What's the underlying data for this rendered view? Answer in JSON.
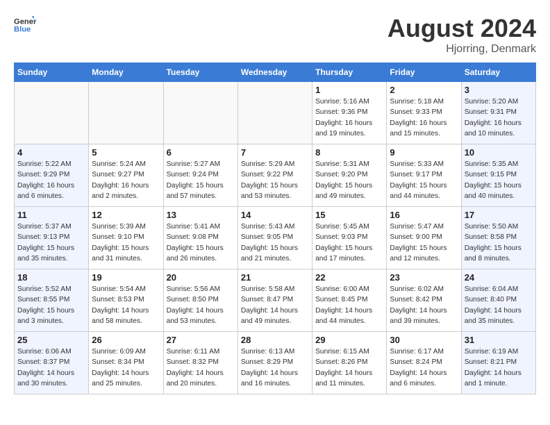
{
  "header": {
    "logo_general": "General",
    "logo_blue": "Blue",
    "month_title": "August 2024",
    "location": "Hjorring, Denmark"
  },
  "weekdays": [
    "Sunday",
    "Monday",
    "Tuesday",
    "Wednesday",
    "Thursday",
    "Friday",
    "Saturday"
  ],
  "weeks": [
    [
      {
        "day": "",
        "info": "",
        "empty": true
      },
      {
        "day": "",
        "info": "",
        "empty": true
      },
      {
        "day": "",
        "info": "",
        "empty": true
      },
      {
        "day": "",
        "info": "",
        "empty": true
      },
      {
        "day": "1",
        "info": "Sunrise: 5:16 AM\nSunset: 9:36 PM\nDaylight: 16 hours\nand 19 minutes."
      },
      {
        "day": "2",
        "info": "Sunrise: 5:18 AM\nSunset: 9:33 PM\nDaylight: 16 hours\nand 15 minutes."
      },
      {
        "day": "3",
        "info": "Sunrise: 5:20 AM\nSunset: 9:31 PM\nDaylight: 16 hours\nand 10 minutes.",
        "weekend": true
      }
    ],
    [
      {
        "day": "4",
        "info": "Sunrise: 5:22 AM\nSunset: 9:29 PM\nDaylight: 16 hours\nand 6 minutes.",
        "weekend": true
      },
      {
        "day": "5",
        "info": "Sunrise: 5:24 AM\nSunset: 9:27 PM\nDaylight: 16 hours\nand 2 minutes."
      },
      {
        "day": "6",
        "info": "Sunrise: 5:27 AM\nSunset: 9:24 PM\nDaylight: 15 hours\nand 57 minutes."
      },
      {
        "day": "7",
        "info": "Sunrise: 5:29 AM\nSunset: 9:22 PM\nDaylight: 15 hours\nand 53 minutes."
      },
      {
        "day": "8",
        "info": "Sunrise: 5:31 AM\nSunset: 9:20 PM\nDaylight: 15 hours\nand 49 minutes."
      },
      {
        "day": "9",
        "info": "Sunrise: 5:33 AM\nSunset: 9:17 PM\nDaylight: 15 hours\nand 44 minutes."
      },
      {
        "day": "10",
        "info": "Sunrise: 5:35 AM\nSunset: 9:15 PM\nDaylight: 15 hours\nand 40 minutes.",
        "weekend": true
      }
    ],
    [
      {
        "day": "11",
        "info": "Sunrise: 5:37 AM\nSunset: 9:13 PM\nDaylight: 15 hours\nand 35 minutes.",
        "weekend": true
      },
      {
        "day": "12",
        "info": "Sunrise: 5:39 AM\nSunset: 9:10 PM\nDaylight: 15 hours\nand 31 minutes."
      },
      {
        "day": "13",
        "info": "Sunrise: 5:41 AM\nSunset: 9:08 PM\nDaylight: 15 hours\nand 26 minutes."
      },
      {
        "day": "14",
        "info": "Sunrise: 5:43 AM\nSunset: 9:05 PM\nDaylight: 15 hours\nand 21 minutes."
      },
      {
        "day": "15",
        "info": "Sunrise: 5:45 AM\nSunset: 9:03 PM\nDaylight: 15 hours\nand 17 minutes."
      },
      {
        "day": "16",
        "info": "Sunrise: 5:47 AM\nSunset: 9:00 PM\nDaylight: 15 hours\nand 12 minutes."
      },
      {
        "day": "17",
        "info": "Sunrise: 5:50 AM\nSunset: 8:58 PM\nDaylight: 15 hours\nand 8 minutes.",
        "weekend": true
      }
    ],
    [
      {
        "day": "18",
        "info": "Sunrise: 5:52 AM\nSunset: 8:55 PM\nDaylight: 15 hours\nand 3 minutes.",
        "weekend": true
      },
      {
        "day": "19",
        "info": "Sunrise: 5:54 AM\nSunset: 8:53 PM\nDaylight: 14 hours\nand 58 minutes."
      },
      {
        "day": "20",
        "info": "Sunrise: 5:56 AM\nSunset: 8:50 PM\nDaylight: 14 hours\nand 53 minutes."
      },
      {
        "day": "21",
        "info": "Sunrise: 5:58 AM\nSunset: 8:47 PM\nDaylight: 14 hours\nand 49 minutes."
      },
      {
        "day": "22",
        "info": "Sunrise: 6:00 AM\nSunset: 8:45 PM\nDaylight: 14 hours\nand 44 minutes."
      },
      {
        "day": "23",
        "info": "Sunrise: 6:02 AM\nSunset: 8:42 PM\nDaylight: 14 hours\nand 39 minutes."
      },
      {
        "day": "24",
        "info": "Sunrise: 6:04 AM\nSunset: 8:40 PM\nDaylight: 14 hours\nand 35 minutes.",
        "weekend": true
      }
    ],
    [
      {
        "day": "25",
        "info": "Sunrise: 6:06 AM\nSunset: 8:37 PM\nDaylight: 14 hours\nand 30 minutes.",
        "weekend": true
      },
      {
        "day": "26",
        "info": "Sunrise: 6:09 AM\nSunset: 8:34 PM\nDaylight: 14 hours\nand 25 minutes."
      },
      {
        "day": "27",
        "info": "Sunrise: 6:11 AM\nSunset: 8:32 PM\nDaylight: 14 hours\nand 20 minutes."
      },
      {
        "day": "28",
        "info": "Sunrise: 6:13 AM\nSunset: 8:29 PM\nDaylight: 14 hours\nand 16 minutes."
      },
      {
        "day": "29",
        "info": "Sunrise: 6:15 AM\nSunset: 8:26 PM\nDaylight: 14 hours\nand 11 minutes."
      },
      {
        "day": "30",
        "info": "Sunrise: 6:17 AM\nSunset: 8:24 PM\nDaylight: 14 hours\nand 6 minutes."
      },
      {
        "day": "31",
        "info": "Sunrise: 6:19 AM\nSunset: 8:21 PM\nDaylight: 14 hours\nand 1 minute.",
        "weekend": true
      }
    ]
  ]
}
